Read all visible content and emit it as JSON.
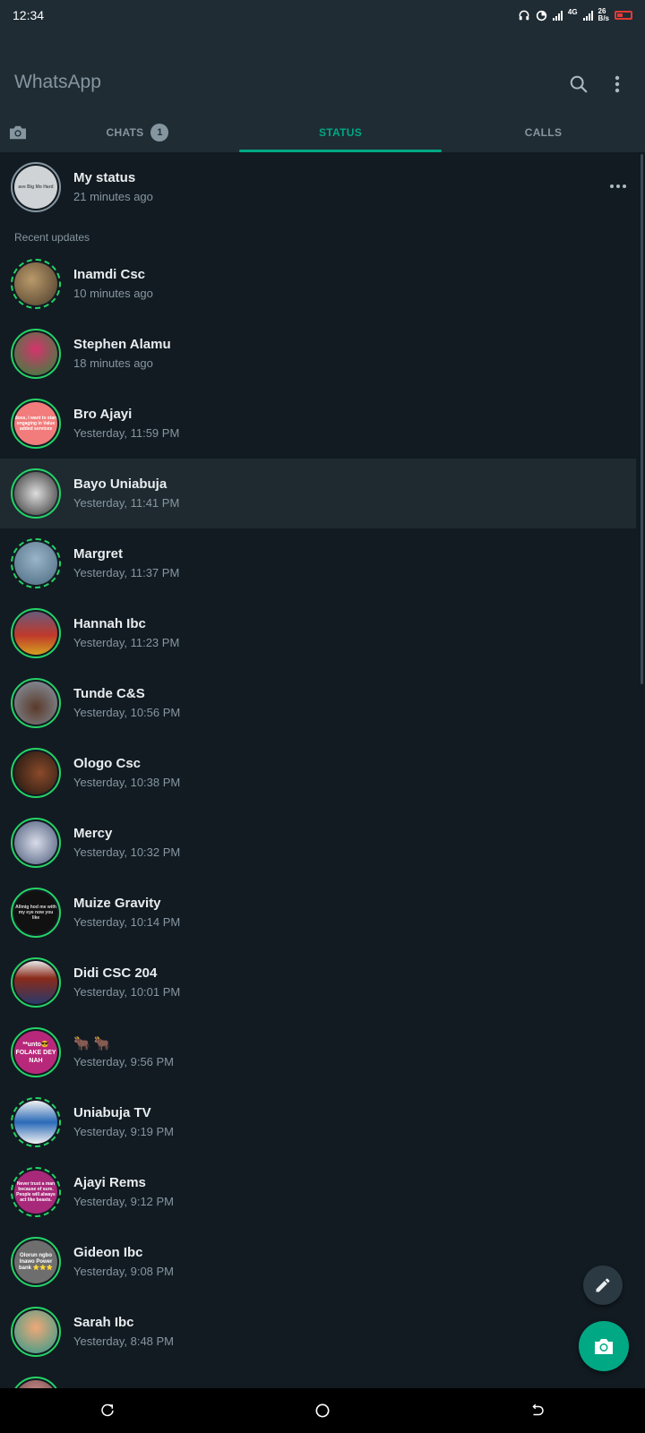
{
  "statusbar": {
    "time": "12:34",
    "network": "4G",
    "speed": "26",
    "speed_unit": "B/s"
  },
  "app": {
    "title": "WhatsApp"
  },
  "tabs": [
    {
      "label": "CHATS",
      "badge": "1"
    },
    {
      "label": "STATUS",
      "active": true
    },
    {
      "label": "CALLS"
    }
  ],
  "my_status": {
    "name": "My status",
    "time": "21 minutes ago",
    "thumb_text": "ave Big Mo Hard"
  },
  "recent_label": "Recent updates",
  "contacts": [
    {
      "name": "Inamdi Csc",
      "time": "10 minutes ago"
    },
    {
      "name": "Stephen Alamu",
      "time": "18 minutes ago"
    },
    {
      "name": "Bro Ajayi",
      "time": "Yesterday, 11:59 PM",
      "thumb_text": "Boss, I want to start engaging in Value added services"
    },
    {
      "name": "Bayo Uniabuja",
      "time": "Yesterday, 11:41 PM"
    },
    {
      "name": "Margret",
      "time": "Yesterday, 11:37 PM"
    },
    {
      "name": "Hannah Ibc",
      "time": "Yesterday, 11:23 PM"
    },
    {
      "name": "Tunde C&S",
      "time": "Yesterday, 10:56 PM"
    },
    {
      "name": "Ologo Csc",
      "time": "Yesterday, 10:38 PM"
    },
    {
      "name": "Mercy",
      "time": "Yesterday, 10:32 PM"
    },
    {
      "name": "Muize Gravity",
      "time": "Yesterday, 10:14 PM",
      "thumb_text": "Allmig hod me with my eye now you like"
    },
    {
      "name": "Didi CSC 204",
      "time": "Yesterday, 10:01 PM"
    },
    {
      "name": "🐂 🐂",
      "time": "Yesterday, 9:56 PM",
      "thumb_text": "**unto😎 FOLAKE DEY NAH"
    },
    {
      "name": "Uniabuja TV",
      "time": "Yesterday, 9:19 PM"
    },
    {
      "name": "Ajayi Rems",
      "time": "Yesterday, 9:12 PM",
      "thumb_text": "Never trust a man because of sure. People will always act like beasts."
    },
    {
      "name": "Gideon Ibc",
      "time": "Yesterday, 9:08 PM",
      "thumb_text": "Olorun ngbo Inawo Power bank ⭐⭐⭐"
    },
    {
      "name": "Sarah Ibc",
      "time": "Yesterday, 8:48 PM"
    }
  ],
  "colors": {
    "accent": "#00a884",
    "ring_unseen": "#25d366",
    "background": "#121b22",
    "header": "#1f2c34"
  }
}
